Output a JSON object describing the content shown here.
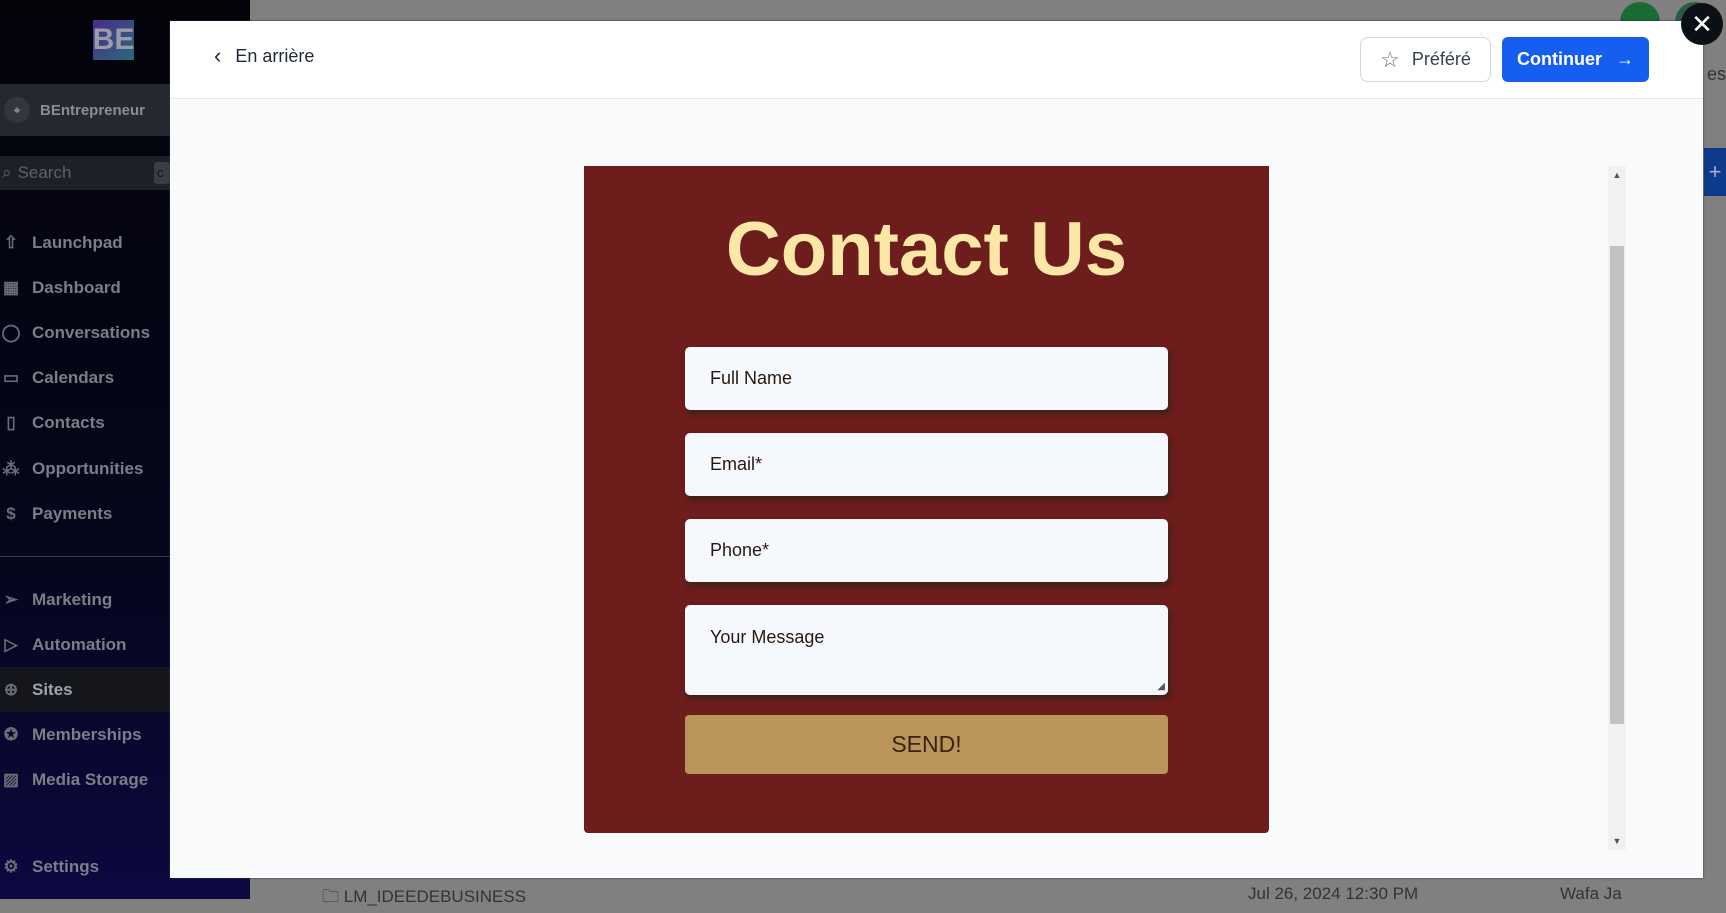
{
  "sidebar": {
    "logo": "BE",
    "account": "BEntrepreneur",
    "search_placeholder": "Search",
    "search_shortcut": "c",
    "items": [
      {
        "label": "Launchpad",
        "icon": "launchpad-icon"
      },
      {
        "label": "Dashboard",
        "icon": "dashboard-icon"
      },
      {
        "label": "Conversations",
        "icon": "chat-icon"
      },
      {
        "label": "Calendars",
        "icon": "calendar-icon"
      },
      {
        "label": "Contacts",
        "icon": "contacts-icon"
      },
      {
        "label": "Opportunities",
        "icon": "opportunities-icon"
      },
      {
        "label": "Payments",
        "icon": "payments-icon"
      },
      {
        "label": "Marketing",
        "icon": "send-icon"
      },
      {
        "label": "Automation",
        "icon": "automation-icon"
      },
      {
        "label": "Sites",
        "icon": "sites-icon",
        "active": true
      },
      {
        "label": "Memberships",
        "icon": "badge-icon"
      },
      {
        "label": "Media Storage",
        "icon": "image-icon"
      },
      {
        "label": "Settings",
        "icon": "gear-icon"
      }
    ]
  },
  "background": {
    "top_right_text": "es",
    "row_name": "LM_IDEEDEBUSINESS",
    "row_date": "Jul 26, 2024 12:30 PM",
    "row_user": "Wafa Ja"
  },
  "modal": {
    "back_label": "En arrière",
    "favorite_label": "Préféré",
    "continue_label": "Continuer",
    "preview": {
      "title": "Contact Us",
      "fields": [
        "Full Name",
        "Email*",
        "Phone*"
      ],
      "message_placeholder": "Your Message",
      "submit_label": "SEND!",
      "colors": {
        "background": "#6d1d1b",
        "title": "#fde7a6",
        "button": "#bb9459"
      }
    }
  },
  "colors": {
    "primary": "#155eef"
  }
}
